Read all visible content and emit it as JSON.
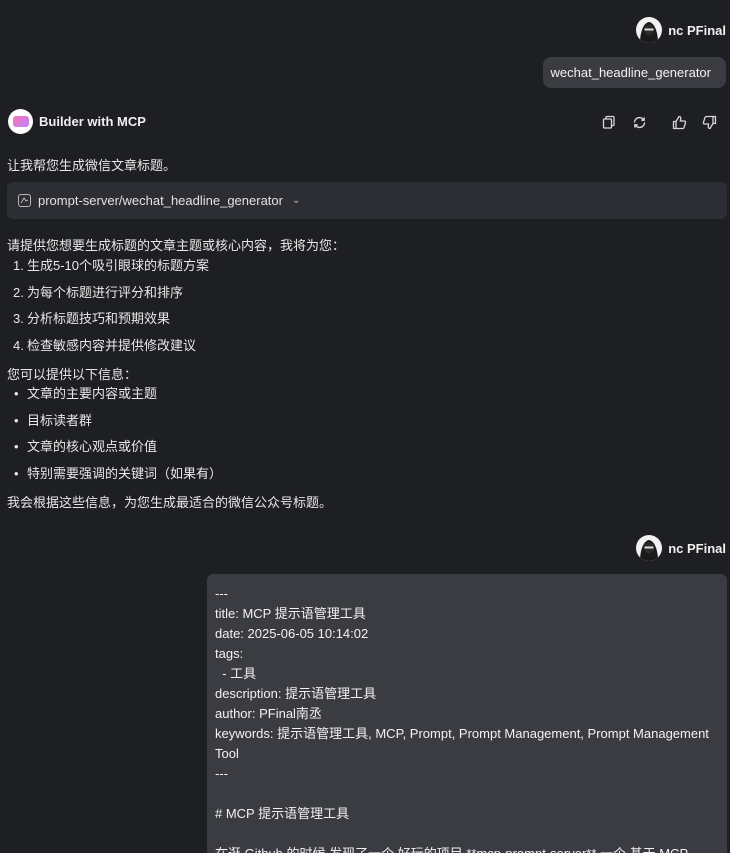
{
  "user": {
    "name": "nc PFinal",
    "avatar_icon": "hooded-hacker-icon"
  },
  "messages": {
    "user_message_1": "wechat_headline_generator",
    "bot": {
      "name": "Builder with MCP",
      "intro": "让我帮您生成微信文章标题。",
      "tool_call": "prompt-server/wechat_headline_generator",
      "prompt_line": "请提供您想要生成标题的文章主题或核心内容，我将为您：",
      "steps": [
        {
          "num": "1.",
          "text": "生成5-10个吸引眼球的标题方案"
        },
        {
          "num": "2.",
          "text": "为每个标题进行评分和排序"
        },
        {
          "num": "3.",
          "text": "分析标题技巧和预期效果"
        },
        {
          "num": "4.",
          "text": "检查敏感内容并提供修改建议"
        }
      ],
      "info_intro": "您可以提供以下信息：",
      "info_items": [
        "文章的主要内容或主题",
        "目标读者群",
        "文章的核心观点或价值",
        "特别需要强调的关键词（如果有）"
      ],
      "closing": "我会根据这些信息，为您生成最适合的微信公众号标题。"
    },
    "user_message_2_lines": [
      "---",
      "title: MCP 提示语管理工具",
      "date: 2025-06-05 10:14:02",
      "tags:",
      "  - 工具",
      "description: 提示语管理工具",
      "author: PFinal南丞",
      "keywords: 提示语管理工具, MCP, Prompt, Prompt Management, Prompt Management Tool",
      "---",
      "",
      "# MCP 提示语管理工具",
      "",
      "在逛 Github 的时候 发现了一个 好玩的项目 **mcp-prompt-server** 一个 基于 MCP"
    ]
  },
  "actions": {
    "copy": "copy-icon",
    "regenerate": "refresh-icon",
    "like": "thumbs-up-icon",
    "dislike": "thumbs-down-icon"
  },
  "colors": {
    "background": "#1e1f22",
    "bubble": "#3a3c42",
    "tool_box": "#2c2e33"
  }
}
